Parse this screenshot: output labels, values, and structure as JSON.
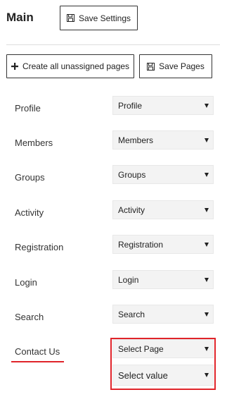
{
  "header": {
    "title": "Main",
    "save_settings_label": "Save Settings"
  },
  "toolbar": {
    "create_label": "Create all unassigned pages",
    "save_pages_label": "Save Pages"
  },
  "rows": [
    {
      "label": "Profile",
      "value": "Profile"
    },
    {
      "label": "Members",
      "value": "Members"
    },
    {
      "label": "Groups",
      "value": "Groups"
    },
    {
      "label": "Activity",
      "value": "Activity"
    },
    {
      "label": "Registration",
      "value": "Registration"
    },
    {
      "label": "Login",
      "value": "Login"
    },
    {
      "label": "Search",
      "value": "Search"
    },
    {
      "label": "Contact Us",
      "value": "Select Page"
    }
  ],
  "extra_select": {
    "value": "Select value"
  },
  "annotation": {
    "color": "#e0242a"
  },
  "icons": {
    "save": "floppy-disk-icon",
    "create": "plus-icon",
    "dropdown": "caret-down-icon"
  }
}
